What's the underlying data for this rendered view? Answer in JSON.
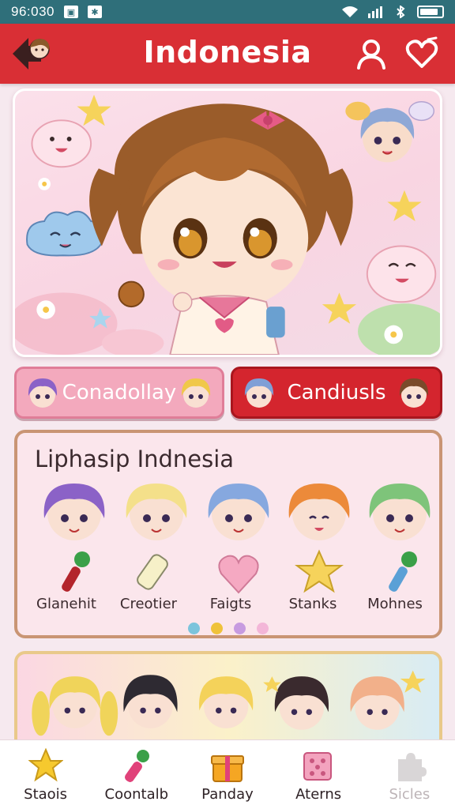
{
  "status_bar": {
    "time": "96:030",
    "icons": [
      "notification-icon",
      "app-icon",
      "wifi-icon",
      "signal-icon",
      "bluetooth-icon",
      "battery-icon"
    ]
  },
  "header": {
    "title": "Indonesia",
    "icons": {
      "back": "back-arrow-icon",
      "profile": "profile-icon",
      "favorite": "heart-icon"
    },
    "color": "#d92f35"
  },
  "actions": {
    "left_label": "Conadollay",
    "right_label": "Candiusls"
  },
  "list_card": {
    "title": "Liphasip Indnesia",
    "items": [
      {
        "label": "Glanehit",
        "icon": "microphone-icon"
      },
      {
        "label": "Creotier",
        "icon": "lightstick-icon"
      },
      {
        "label": "Faigts",
        "icon": "heart-icon"
      },
      {
        "label": "Stanks",
        "icon": "star-icon"
      },
      {
        "label": "Mohnes",
        "icon": "microphone-icon"
      }
    ],
    "page_dots": [
      "#7cc4dc",
      "#efc23a",
      "#c79be0",
      "#f3b6d8"
    ]
  },
  "bottom_nav": [
    {
      "label": "Staois",
      "icon": "star-icon",
      "enabled": true
    },
    {
      "label": "Coontalb",
      "icon": "microphone-icon",
      "enabled": true
    },
    {
      "label": "Panday",
      "icon": "gift-box-icon",
      "enabled": true
    },
    {
      "label": "Aterns",
      "icon": "dice-icon",
      "enabled": true
    },
    {
      "label": "Sicles",
      "icon": "puzzle-icon",
      "enabled": false
    }
  ],
  "colors": {
    "accent": "#d92f35",
    "pink": "#f3a9bd",
    "status_bar": "#2f6f7a",
    "card_border": "#c99574"
  }
}
